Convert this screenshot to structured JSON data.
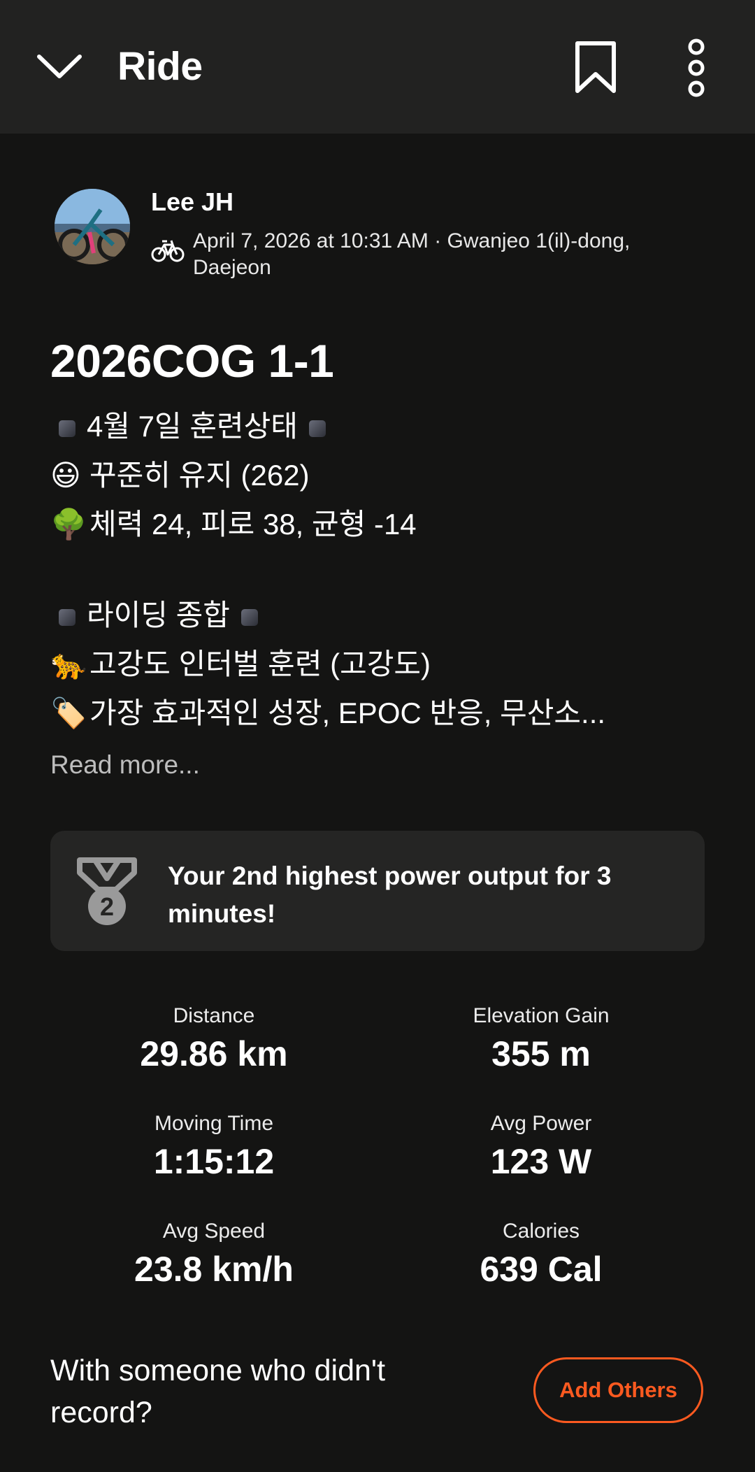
{
  "header": {
    "title": "Ride",
    "back_icon": "chevron-down-icon",
    "bookmark_icon": "bookmark-icon",
    "more_icon": "more-vertical-icon"
  },
  "athlete": {
    "name": "Lee JH",
    "activity_icon": "bike-icon",
    "meta": "April 7, 2026 at 10:31 AM · Gwanjeo 1(il)-dong, Daejeon"
  },
  "activity": {
    "title": "2026COG 1-1",
    "description_lines": [
      {
        "emoji": "",
        "text": "4월 7일 훈련상태",
        "bracketed": true
      },
      {
        "emoji": "😃",
        "text": "꾸준히 유지 (262)"
      },
      {
        "emoji": "🌳",
        "text": "체력 24, 피로 38, 균형 -14"
      },
      {
        "emoji": "",
        "text": ""
      },
      {
        "emoji": "",
        "text": "라이딩 종합",
        "bracketed": true
      },
      {
        "emoji": "🐆",
        "text": "고강도 인터벌 훈련 (고강도)"
      },
      {
        "emoji": "🏷️",
        "text": "가장 효과적인 성장, EPOC 반응, 무산소..."
      }
    ],
    "read_more": "Read more..."
  },
  "achievement": {
    "icon": "medal-2-icon",
    "rank": "2",
    "text": "Your 2nd highest power output for 3 minutes!"
  },
  "stats": {
    "distance": {
      "label": "Distance",
      "value": "29.86 km"
    },
    "elevation": {
      "label": "Elevation Gain",
      "value": "355 m"
    },
    "moving_time": {
      "label": "Moving Time",
      "value": "1:15:12"
    },
    "avg_power": {
      "label": "Avg Power",
      "value": "123 W"
    },
    "avg_speed": {
      "label": "Avg Speed",
      "value": "23.8 km/h"
    },
    "calories": {
      "label": "Calories",
      "value": "639 Cal"
    }
  },
  "group": {
    "prompt": "With someone who didn't record?",
    "button": "Add Others"
  },
  "colors": {
    "background": "#141413",
    "header_bg": "#222221",
    "card_bg": "#252524",
    "accent": "#fc5a20"
  }
}
